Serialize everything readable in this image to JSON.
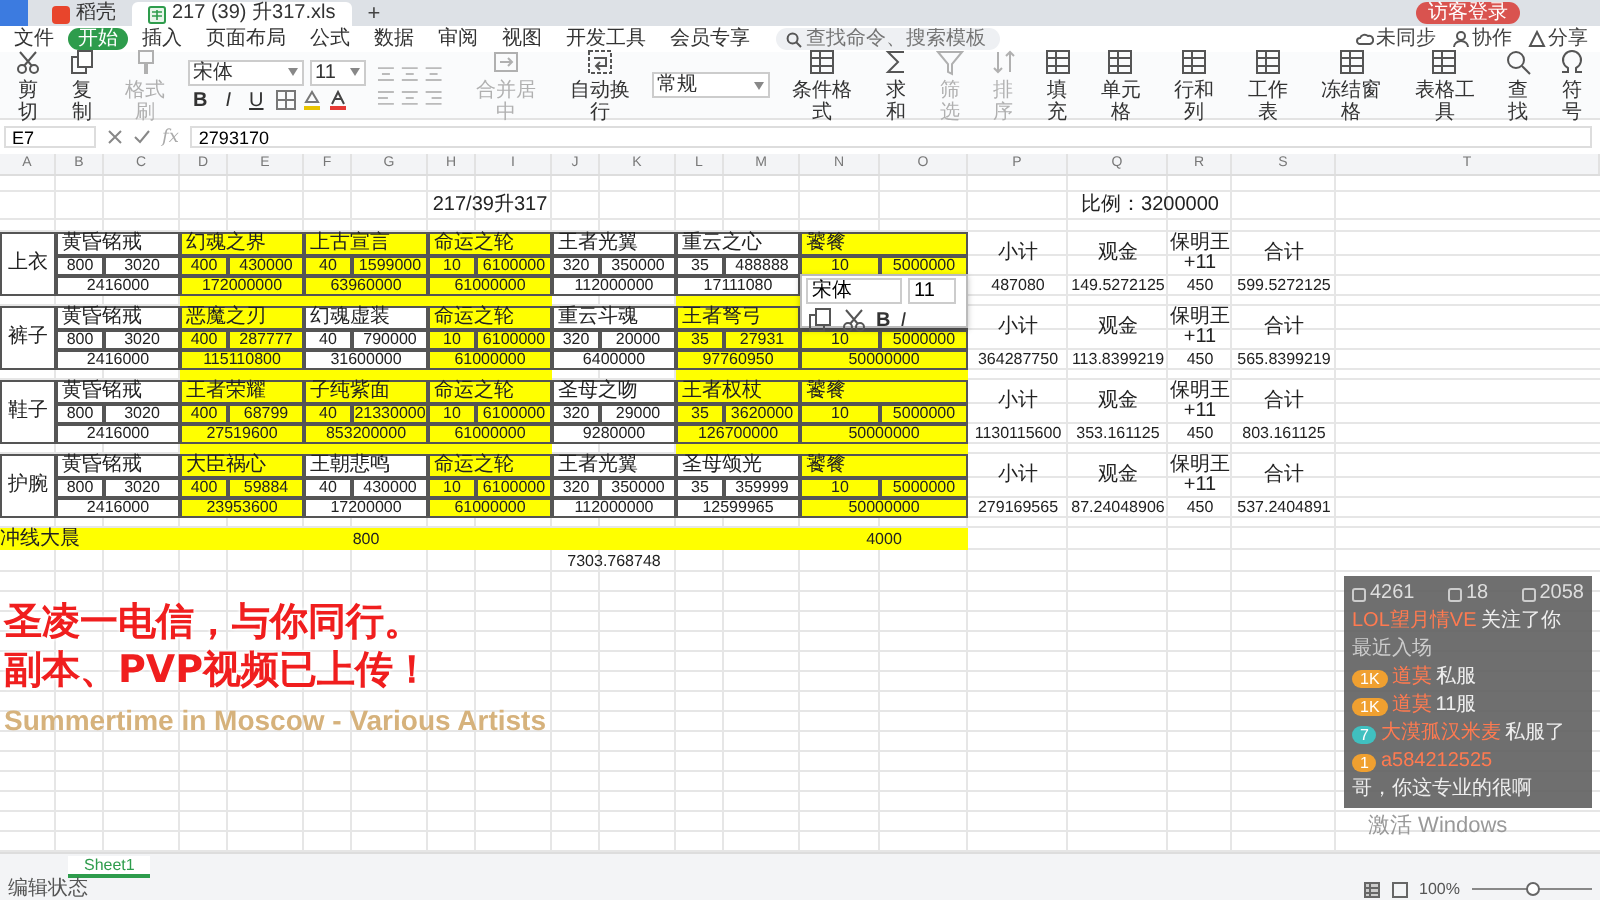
{
  "tabs": [
    {
      "label": "稻壳",
      "selected": false,
      "kind": "docer"
    },
    {
      "label": "217 (39) 升317.xls",
      "selected": true,
      "kind": "sheet"
    }
  ],
  "new_tab": "+",
  "login_button": "访客登录",
  "menu": [
    {
      "label": "文件",
      "selected": false
    },
    {
      "label": "开始",
      "selected": true
    },
    {
      "label": "插入",
      "selected": false
    },
    {
      "label": "页面布局",
      "selected": false
    },
    {
      "label": "公式",
      "selected": false
    },
    {
      "label": "数据",
      "selected": false
    },
    {
      "label": "审阅",
      "selected": false
    },
    {
      "label": "视图",
      "selected": false
    },
    {
      "label": "开发工具",
      "selected": false
    },
    {
      "label": "会员专享",
      "selected": false
    }
  ],
  "command_search": {
    "placeholder": "查找命令、搜索模板"
  },
  "sync_actions": [
    {
      "label": "未同步",
      "kind": "cloud"
    },
    {
      "label": "协作",
      "kind": "person"
    },
    {
      "label": "分享",
      "kind": "share"
    }
  ],
  "toolbar": {
    "clipboard": [
      {
        "label": "剪切",
        "kind": "cut",
        "disabled": false
      },
      {
        "label": "复制",
        "kind": "copy",
        "disabled": false
      },
      {
        "label": "格式刷",
        "kind": "brush",
        "disabled": true
      }
    ],
    "font": "宋体",
    "font_size": "11",
    "format_buttons": [
      {
        "label": "B",
        "kind": "bold"
      },
      {
        "label": "I",
        "kind": "italic"
      },
      {
        "label": "U",
        "kind": "underline"
      }
    ],
    "alignment": [
      {
        "label": "合并居中",
        "kind": "merge",
        "disabled": true
      },
      {
        "label": "自动换行",
        "kind": "wrap",
        "disabled": false
      }
    ],
    "number_format": "常规",
    "commands": [
      {
        "label": "条件格式",
        "kind": "table",
        "disabled": false
      },
      {
        "label": "求和",
        "kind": "sum",
        "disabled": false
      },
      {
        "label": "筛选",
        "kind": "filter",
        "disabled": true
      },
      {
        "label": "排序",
        "kind": "sort",
        "disabled": true
      },
      {
        "label": "填充",
        "kind": "table",
        "disabled": false
      },
      {
        "label": "单元格",
        "kind": "table",
        "disabled": false
      },
      {
        "label": "行和列",
        "kind": "table",
        "disabled": false
      },
      {
        "label": "工作表",
        "kind": "table",
        "disabled": false
      },
      {
        "label": "冻结窗格",
        "kind": "table",
        "disabled": false
      },
      {
        "label": "表格工具",
        "kind": "table",
        "disabled": false
      },
      {
        "label": "查找",
        "kind": "find",
        "disabled": false
      },
      {
        "label": "符号",
        "kind": "symbol",
        "disabled": false
      }
    ]
  },
  "formula_bar": {
    "cell": "E7",
    "function_label": "fx",
    "value": "2793170"
  },
  "sheet": {
    "columns": [
      "A",
      "B",
      "C",
      "D",
      "E",
      "F",
      "G",
      "H",
      "I",
      "J",
      "K",
      "L",
      "M",
      "N",
      "O",
      "P",
      "Q",
      "R",
      "S",
      "T"
    ],
    "title": "217/39升317",
    "ratio": "比例：3200000",
    "blocks": [
      {
        "label": "上衣",
        "subtotal_label": "小计",
        "cash_label": "观金",
        "bonus_label": "保明王+11",
        "total_label": "合计",
        "subtotal": "487080",
        "cash": "149.5272125",
        "bonus": "450",
        "total": "599.5272125",
        "items": [
          {
            "name": "黄昏铭戒",
            "qty": "800",
            "price": "3020",
            "total": "2416000",
            "highlighted": false
          },
          {
            "name": "幻魂之界",
            "qty": "400",
            "price": "430000",
            "total": "172000000",
            "highlighted": true
          },
          {
            "name": "上古宣言",
            "qty": "40",
            "price": "1599000",
            "total": "63960000",
            "highlighted": true
          },
          {
            "name": "命运之轮",
            "qty": "10",
            "price": "6100000",
            "total": "61000000",
            "highlighted": true
          },
          {
            "name": "王者光翼",
            "qty": "320",
            "price": "350000",
            "total": "112000000",
            "highlighted": false
          },
          {
            "name": "重云之心",
            "qty": "35",
            "price": "488888",
            "total": "17111080",
            "highlighted": false
          },
          {
            "name": "饕餮",
            "qty": "10",
            "price": "5000000",
            "highlighted": true
          }
        ]
      },
      {
        "label": "裤子",
        "subtotal_label": "小计",
        "cash_label": "观金",
        "bonus_label": "保明王+11",
        "total_label": "合计",
        "subtotal": "364287750",
        "cash": "113.8399219",
        "bonus": "450",
        "total": "565.8399219",
        "items": [
          {
            "name": "黄昏铭戒",
            "qty": "800",
            "price": "3020",
            "total": "2416000",
            "highlighted": false
          },
          {
            "name": "恶魔之刃",
            "qty": "400",
            "price": "287777",
            "total": "115110800",
            "highlighted": true
          },
          {
            "name": "幻魂虚装",
            "qty": "40",
            "price": "790000",
            "total": "31600000",
            "highlighted": false
          },
          {
            "name": "命运之轮",
            "qty": "10",
            "price": "6100000",
            "total": "61000000",
            "highlighted": true
          },
          {
            "name": "重云斗魂",
            "qty": "320",
            "price": "20000",
            "total": "6400000",
            "highlighted": false
          },
          {
            "name": "王者弩弓",
            "qty": "35",
            "price": "27931",
            "total": "97760950",
            "highlighted": true
          },
          {
            "qty": "10",
            "price": "5000000",
            "total": "50000000",
            "highlighted": true
          }
        ]
      },
      {
        "label": "鞋子",
        "subtotal_label": "小计",
        "cash_label": "观金",
        "bonus_label": "保明王+11",
        "total_label": "合计",
        "subtotal": "1130115600",
        "cash": "353.161125",
        "bonus": "450",
        "total": "803.161125",
        "items": [
          {
            "name": "黄昏铭戒",
            "qty": "800",
            "price": "3020",
            "total": "2416000",
            "highlighted": false
          },
          {
            "name": "王者荣耀",
            "qty": "400",
            "price": "68799",
            "total": "27519600",
            "highlighted": true
          },
          {
            "name": "子纯紫面",
            "qty": "40",
            "price": "21330000",
            "total": "853200000",
            "highlighted": true
          },
          {
            "name": "命运之轮",
            "qty": "10",
            "price": "6100000",
            "total": "61000000",
            "highlighted": true
          },
          {
            "name": "圣母之吻",
            "qty": "320",
            "price": "29000",
            "total": "9280000",
            "highlighted": false
          },
          {
            "name": "王者权杖",
            "qty": "35",
            "price": "3620000",
            "total": "126700000",
            "highlighted": true
          },
          {
            "name": "饕餮",
            "qty": "10",
            "price": "5000000",
            "total": "50000000",
            "highlighted": true
          }
        ]
      },
      {
        "label": "护腕",
        "subtotal_label": "小计",
        "cash_label": "观金",
        "bonus_label": "保明王+11",
        "total_label": "合计",
        "subtotal": "279169565",
        "cash": "87.24048906",
        "bonus": "450",
        "total": "537.2404891",
        "items": [
          {
            "name": "黄昏铭戒",
            "qty": "800",
            "price": "3020",
            "total": "2416000",
            "highlighted": false
          },
          {
            "name": "大臣祸心",
            "qty": "400",
            "price": "59884",
            "total": "23953600",
            "highlighted": true
          },
          {
            "name": "王朝悲鸣",
            "qty": "40",
            "price": "430000",
            "total": "17200000",
            "highlighted": false
          },
          {
            "name": "命运之轮",
            "qty": "10",
            "price": "6100000",
            "total": "61000000",
            "highlighted": true
          },
          {
            "name": "王者光翼",
            "qty": "320",
            "price": "350000",
            "total": "112000000",
            "highlighted": false
          },
          {
            "name": "圣母颂光",
            "qty": "35",
            "price": "359999",
            "total": "12599965",
            "highlighted": false
          },
          {
            "name": "饕餮",
            "qty": "10",
            "price": "5000000",
            "total": "50000000",
            "highlighted": true
          }
        ]
      }
    ],
    "footer_label": "冲线大晨",
    "footer_values": [
      "800",
      "4000"
    ],
    "grand_total": "7303.768748"
  },
  "mini_toolbar": {
    "font": "宋体",
    "size": "11",
    "format": [
      "B",
      "I"
    ]
  },
  "sheet_tabs": [
    {
      "label": "Sheet1",
      "selected": true
    }
  ],
  "status_bar": {
    "mode": "编辑状态",
    "zoom": "100%",
    "zoom_slider": {
      "level": 0.5
    }
  },
  "overlay": {
    "slogan": [
      "圣凌一电信，与你同行。",
      "副本、PVP视频已上传！"
    ],
    "now_playing": "Summertime in Moscow - Various Artists"
  },
  "chat": {
    "stats": [
      "4261",
      "18",
      "2058"
    ],
    "follows": [
      {
        "user": "LOL望月情VE",
        "text": "关注了你"
      }
    ],
    "section": "最近入场",
    "messages": [
      {
        "badge": "1K",
        "user": "道莫",
        "text": "私服",
        "color": "#f0a030"
      },
      {
        "badge": "1K",
        "user": "道莫",
        "text": "11服",
        "color": "#f0a030"
      },
      {
        "badge": "7",
        "user": "大漠孤汉米麦",
        "text": "私服了",
        "color": "#40c0c0"
      },
      {
        "badge": "1",
        "user": "a584212525",
        "text": "哥，你这专业的很啊",
        "color": "#f0a030"
      }
    ]
  },
  "windows_notice": "激活 Windows"
}
